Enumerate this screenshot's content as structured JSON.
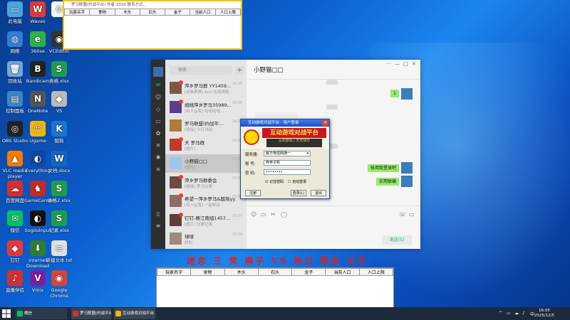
{
  "desktop_icons": [
    {
      "label": "此电脑",
      "glyph": "▭",
      "color": "#4aa3df"
    },
    {
      "label": "Waves",
      "glyph": "W",
      "color": "#e53935"
    },
    {
      "label": "",
      "glyph": "⚙",
      "color": "#f5f5f5"
    },
    {
      "label": "网络",
      "glyph": "◍",
      "color": "#2f7ed8"
    },
    {
      "label": "360se",
      "glyph": "e",
      "color": "#2bb24c"
    },
    {
      "label": "VCEditor",
      "glyph": "◉",
      "color": "#333"
    },
    {
      "label": "回收站",
      "glyph": "🗑",
      "color": "#6fa8dc"
    },
    {
      "label": "Bandicam",
      "glyph": "B",
      "color": "#222"
    },
    {
      "label": "表格.xlsx",
      "glyph": "S",
      "color": "#1e9e4a"
    },
    {
      "label": "控制面板",
      "glyph": "▤",
      "color": "#3d85c6"
    },
    {
      "label": "OneNote",
      "glyph": "N",
      "color": "#555"
    },
    {
      "label": "VS",
      "glyph": "◆",
      "color": "#bbb"
    },
    {
      "label": "OBS Studio",
      "glyph": "◎",
      "color": "#222"
    },
    {
      "label": "Ugame",
      "glyph": "☺",
      "color": "#f2b705"
    },
    {
      "label": "酷狗",
      "glyph": "K",
      "color": "#1976d2"
    },
    {
      "label": "VLC media player",
      "glyph": "▲",
      "color": "#f57c00"
    },
    {
      "label": "Everything",
      "glyph": "◐",
      "color": "#0d47a1"
    },
    {
      "label": "文档.docx",
      "glyph": "W",
      "color": "#1565c0"
    },
    {
      "label": "百度网盘",
      "glyph": "☁",
      "color": "#d32f2f"
    },
    {
      "label": "GameCenter",
      "glyph": "♞",
      "color": "#c62828"
    },
    {
      "label": "表格2.xlsx",
      "glyph": "S",
      "color": "#1e9e4a"
    },
    {
      "label": "微信",
      "glyph": "✉",
      "color": "#07c160"
    },
    {
      "label": "SogouInput",
      "glyph": "◐",
      "color": "#111"
    },
    {
      "label": "记录.xlsx",
      "glyph": "S",
      "color": "#1e9e4a"
    },
    {
      "label": "钉钉",
      "glyph": "◆",
      "color": "#e53935"
    },
    {
      "label": "Internet Download",
      "glyph": "⬇",
      "color": "#2e7d32"
    },
    {
      "label": "新建文本.txt",
      "glyph": "≡",
      "color": "#e0e0e0"
    },
    {
      "label": "直播伴侣",
      "glyph": "♪",
      "color": "#d32f2f"
    },
    {
      "label": "Vmix",
      "glyph": "V",
      "color": "#7b1fa2"
    },
    {
      "label": "Google Chrome",
      "glyph": "◉",
      "color": "#db4437"
    }
  ],
  "top_window": {
    "title": "罗马联盟(约战平台) 作者:2020 联系方式...",
    "columns": [
      "玩家名字",
      "食物",
      "木头",
      "石头",
      "金子",
      "当前人口",
      "人口上限"
    ]
  },
  "wechat": {
    "search_placeholder": "搜索",
    "plus": "+",
    "chat_title": "小野猫□□",
    "window_controls": [
      "···",
      "—",
      "□",
      "✕"
    ],
    "chats": [
      {
        "name": "萍乡罗马群 YY1459...",
        "preview": "[动画表情] Ann 在线观看",
        "time": "16:05",
        "badge": true,
        "active": false
      },
      {
        "name": "胡桃萍乡罗马35989...",
        "preview": "[有人@我] 哈哈哈哈...",
        "time": "16:05",
        "badge": true,
        "active": false
      },
      {
        "name": "罗马联盟(约战平...",
        "preview": "[链接] 今日对战",
        "time": "16:04",
        "badge": false,
        "active": false
      },
      {
        "name": "天 罗马群",
        "preview": "[图片]",
        "time": "16:03",
        "badge": true,
        "active": false
      },
      {
        "name": "小野猫□□",
        "preview": "[图片]",
        "time": "16:00",
        "badge": false,
        "active": true
      },
      {
        "name": "萍乡罗马群委会",
        "preview": "[链接] 罗马比赛",
        "time": "15:59",
        "badge": true,
        "active": false
      },
      {
        "name": "希望一萍乡罗马&酷狗yy...",
        "preview": "[有人@我] 一起来玩",
        "time": "15:58",
        "badge": true,
        "active": false
      },
      {
        "name": "钉钉-赛江南组1457...",
        "preview": "[图片] 比赛记录",
        "time": "15:57",
        "badge": true,
        "active": false
      },
      {
        "name": "球球",
        "preview": "好的",
        "time": "15:50",
        "badge": false,
        "active": false
      }
    ],
    "messages": {
      "bubble_1": "1",
      "bubble_2": "帐用我登录吧",
      "bubble_3": "实用联编"
    },
    "send_label": "发送(S)",
    "tools": [
      "☺",
      "▭",
      "✂",
      "◯"
    ],
    "right_tools": [
      "☏",
      "▭"
    ]
  },
  "login_dialog": {
    "title": "互动游戏对战平台 - 用户登录",
    "banner_title": "互动游戏对战平台",
    "banner_sub": "互动游戏 | 天天快乐",
    "server_label": "服务器:",
    "server_value": "官方电信网通一",
    "account_label": "账 号:",
    "account_value": "养养子料",
    "password_label": "密 码:",
    "password_value": "••••••••",
    "remember_label": "记住密码",
    "auto_label": "自动登录",
    "register_label": "注册",
    "login_label": "登录(L)",
    "exit_label": "退出"
  },
  "red_banner": "迷恋 三 笑 麻子 VS 帅刀 阳宝 公子",
  "bottom_window": {
    "columns": [
      "玩家名字",
      "食物",
      "木头",
      "石头",
      "金子",
      "当前人口",
      "人口上限"
    ]
  },
  "taskbar": {
    "apps": [
      {
        "label": "微信",
        "color": "#07c160"
      },
      {
        "label": "罗马联盟(约战平台)...",
        "color": "#d32f2f"
      },
      {
        "label": "互动游戏对战平台...",
        "color": "#f2b705"
      }
    ],
    "tray_icons": [
      "^",
      "▭",
      "☁",
      "♪",
      "中"
    ],
    "time": "16:05",
    "date": "2025/12/5"
  }
}
